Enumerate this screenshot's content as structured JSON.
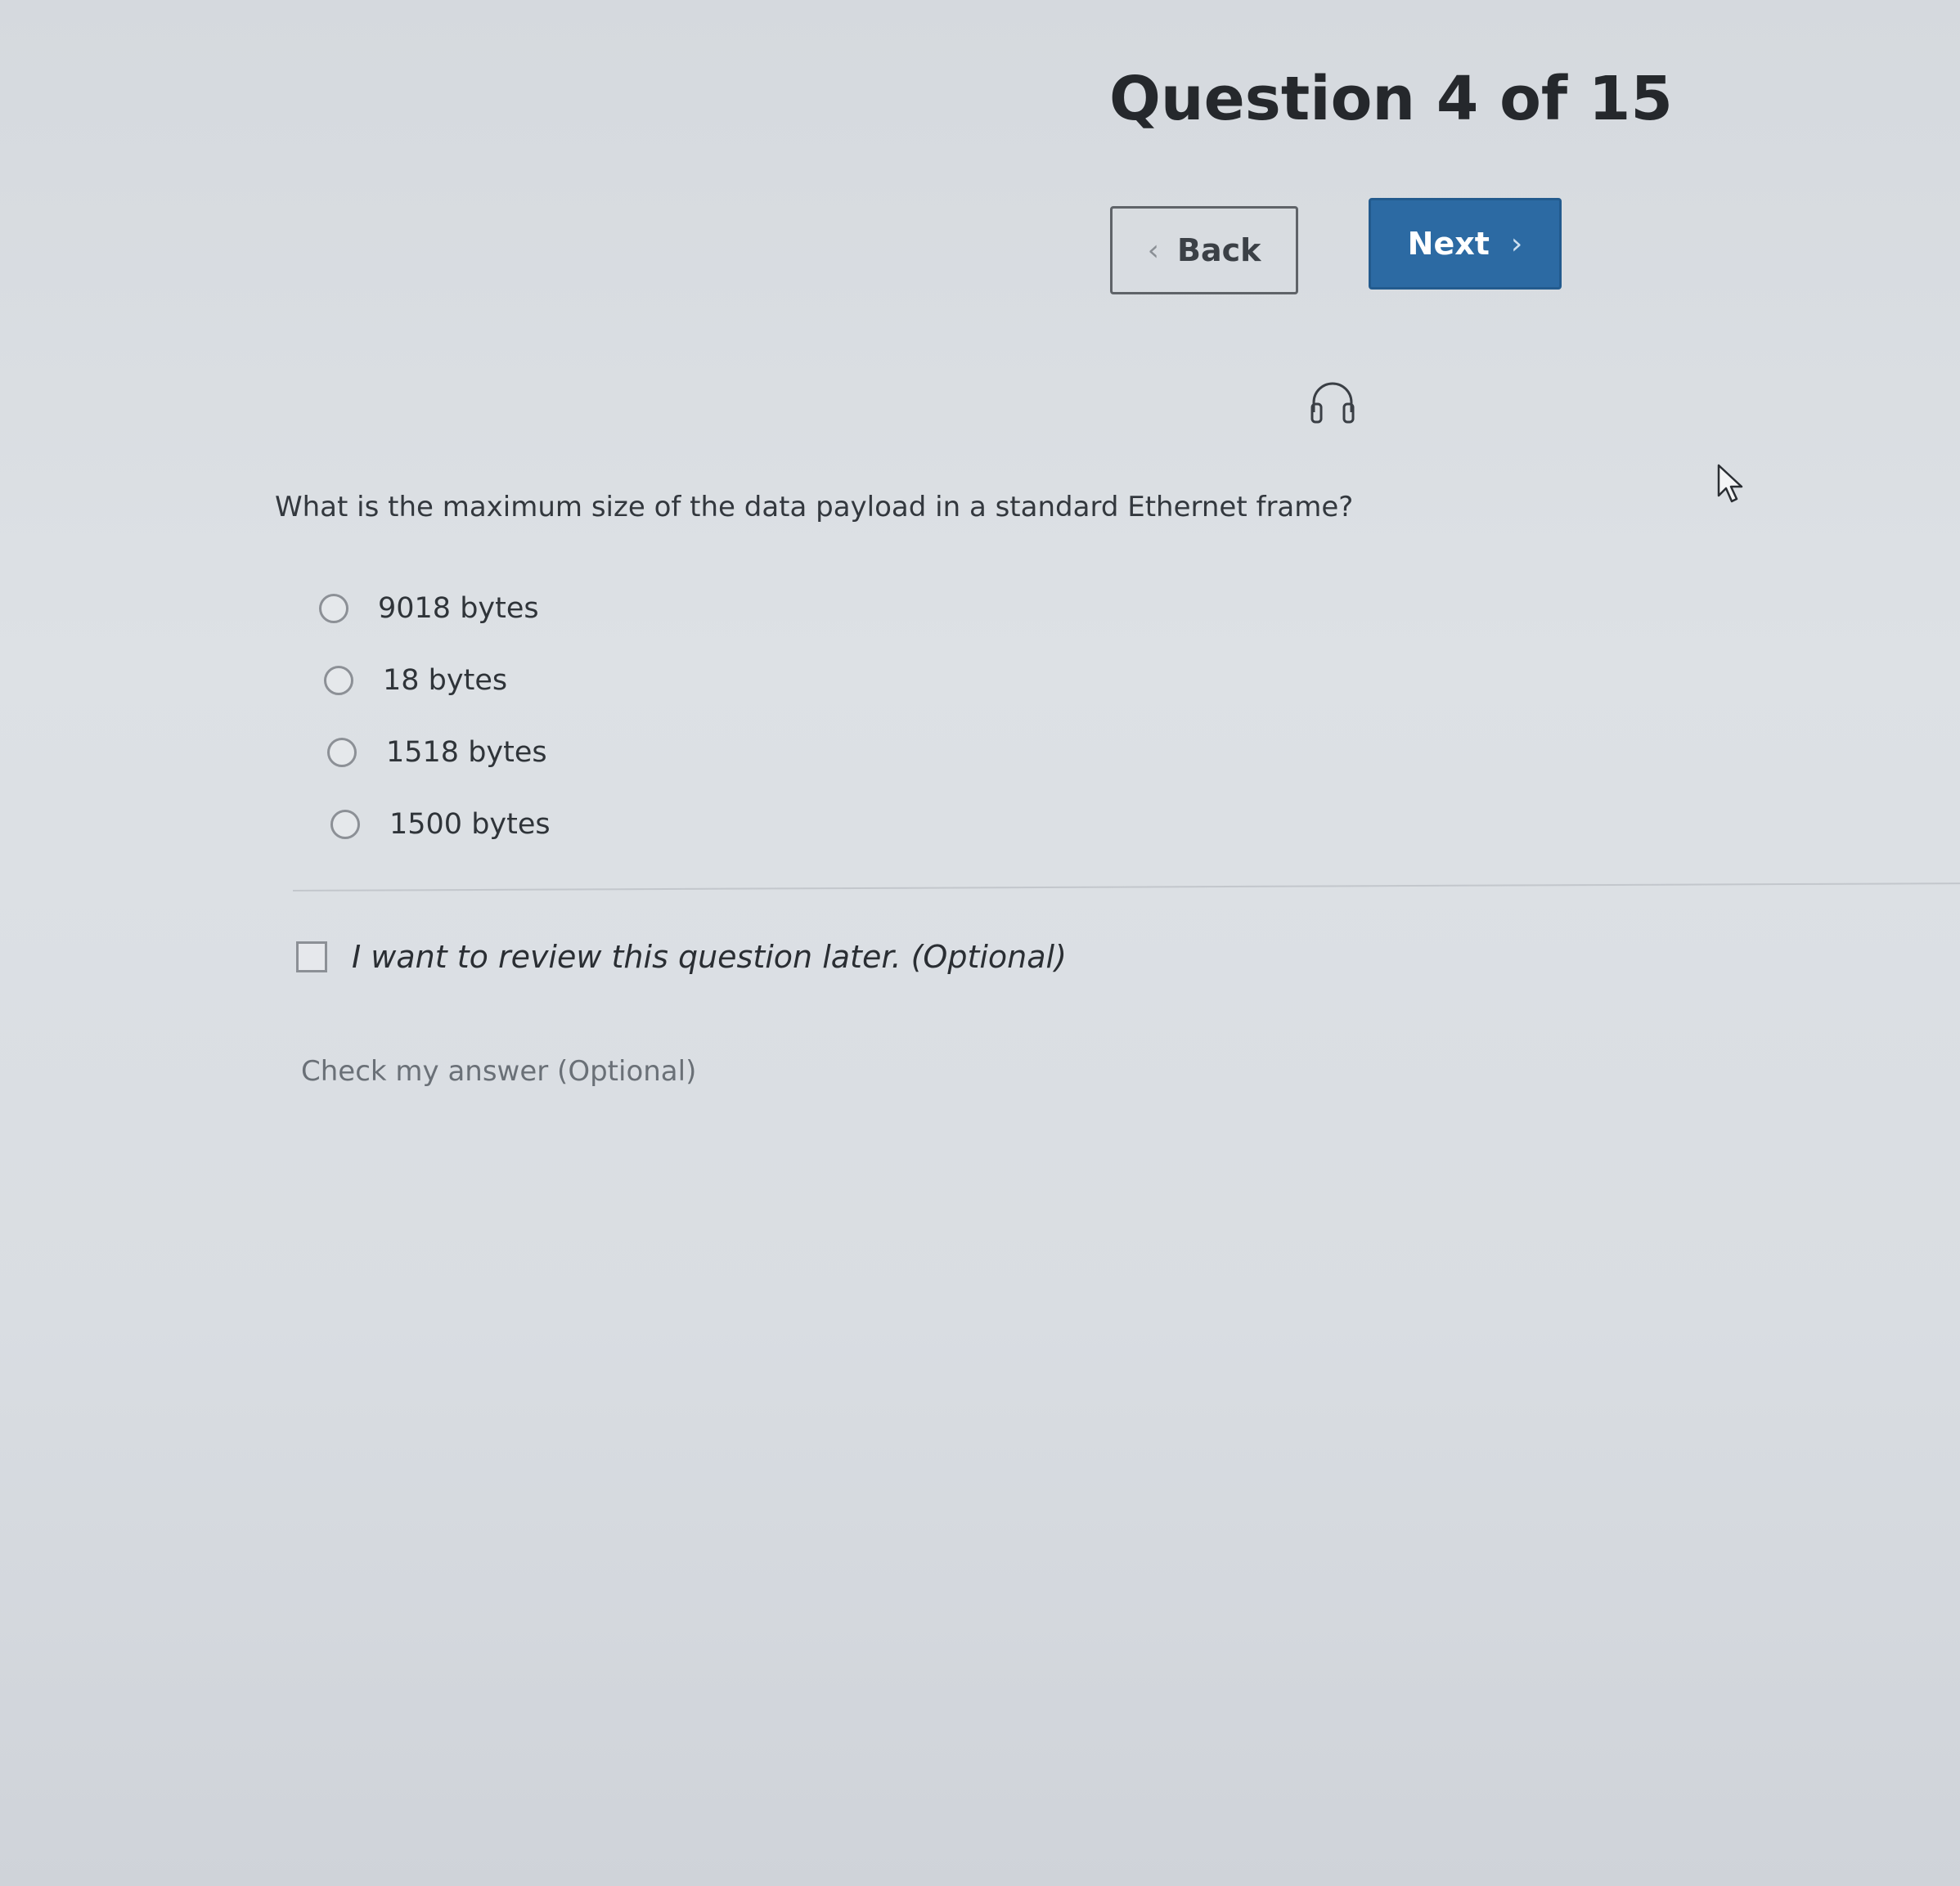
{
  "header": {
    "title": "Question 4 of 15"
  },
  "navigation": {
    "back_label": "Back",
    "next_label": "Next",
    "back_icon": "chevron-left-icon",
    "next_icon": "chevron-right-icon"
  },
  "audio": {
    "icon": "headphones-icon"
  },
  "question": {
    "text": "What is the maximum size of the data payload in a standard Ethernet frame?",
    "options": [
      {
        "label": "9018 bytes",
        "selected": false
      },
      {
        "label": "18 bytes",
        "selected": false
      },
      {
        "label": "1518 bytes",
        "selected": false
      },
      {
        "label": "1500 bytes",
        "selected": false
      }
    ]
  },
  "review": {
    "label": "I want to review this question later. (Optional)",
    "checked": false
  },
  "check_answer": {
    "label": "Check my answer (Optional)"
  },
  "colors": {
    "primary_button": "#2c6aa3",
    "background": "#dde1e5"
  }
}
